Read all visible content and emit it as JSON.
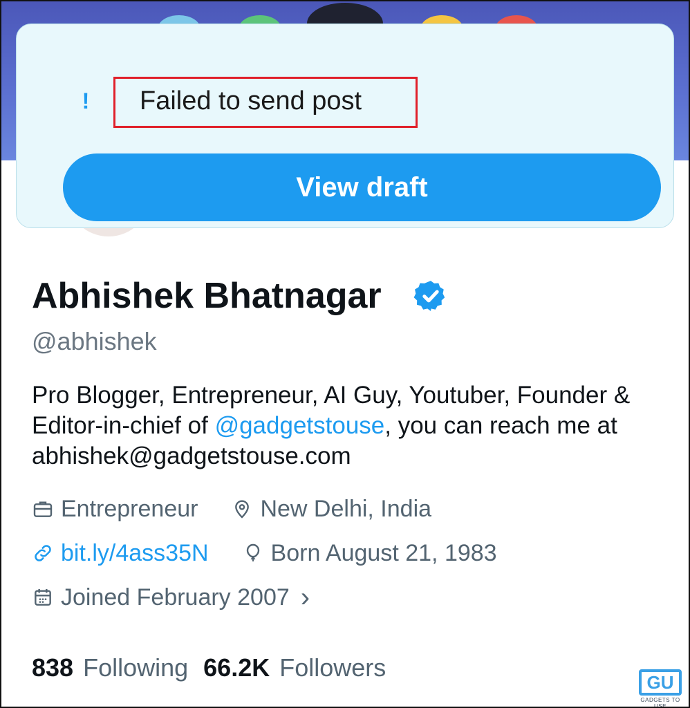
{
  "toast": {
    "message": "Failed to send post",
    "alert_glyph": "!",
    "button_label": "View draft"
  },
  "profile": {
    "name": "Abhishek Bhatnagar",
    "handle": "@abhishek",
    "bio_before": "Pro Blogger, Entrepreneur, AI Guy, Youtuber, Founder & Editor-in-chief of ",
    "bio_mention": "@gadgetstouse",
    "bio_after": ", you can reach me at abhishek@gadgetstouse.com",
    "profession": "Entrepreneur",
    "location": "New Delhi, India",
    "website": "bit.ly/4ass35N",
    "birthday": "Born August 21, 1983",
    "joined": "Joined February 2007",
    "joined_chevron": "›",
    "following_count": "838",
    "following_label": "Following",
    "followers_count": "66.2K",
    "followers_label": "Followers"
  },
  "watermark": {
    "logo": "GU",
    "text": "GADGETS TO USE"
  },
  "colors": {
    "accent": "#1d9bf0",
    "toast_bg": "#e8f8fc",
    "highlight_box": "#e0202a",
    "muted_text": "#536471"
  },
  "icons": [
    "alert-icon",
    "verified-badge-icon",
    "briefcase-icon",
    "location-pin-icon",
    "link-icon",
    "birthday-balloon-icon",
    "calendar-icon",
    "chevron-right-icon"
  ]
}
